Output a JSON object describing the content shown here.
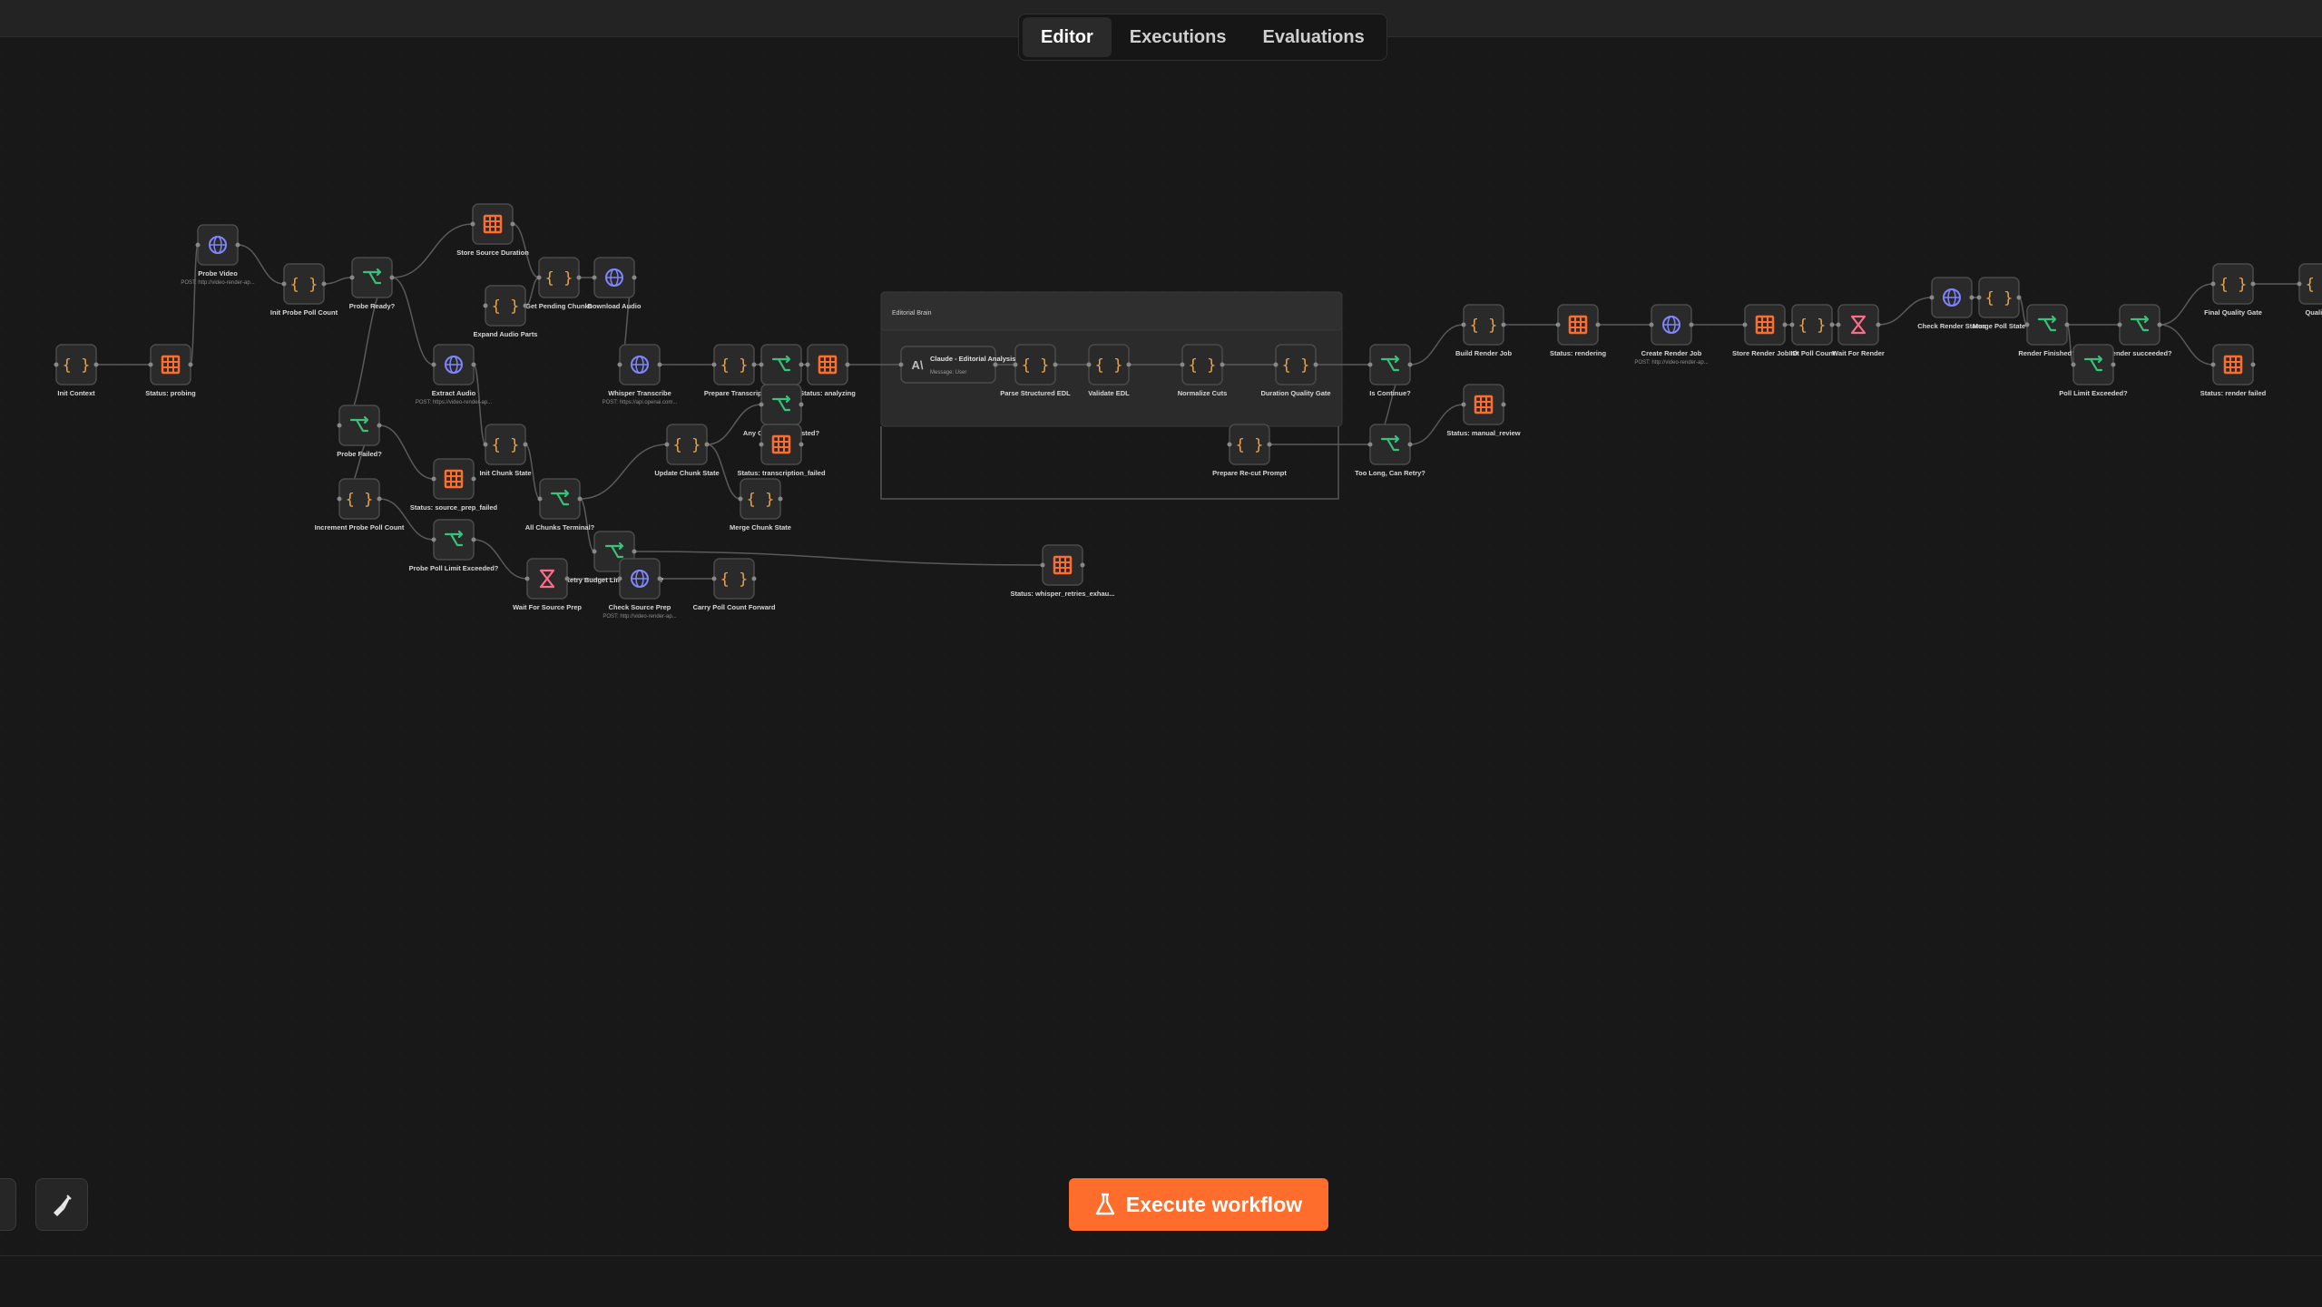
{
  "tabs": [
    {
      "label": "Editor",
      "active": true
    },
    {
      "label": "Executions",
      "active": false
    },
    {
      "label": "Evaluations",
      "active": false
    }
  ],
  "execute_button": {
    "label": "Execute workflow"
  },
  "group": {
    "title": "Editorial Brain"
  },
  "colors": {
    "code": "#e8a24a",
    "table": "#ff6d2d",
    "http": "#7f86ff",
    "if": "#39c37a",
    "wait": "#ff6b8a",
    "ai": "#bdbdbd"
  },
  "nodes": [
    {
      "id": "n0",
      "label": "Init Context",
      "type": "code"
    },
    {
      "id": "n1",
      "label": "Status: probing",
      "type": "table"
    },
    {
      "id": "n2",
      "label": "Probe Video",
      "sub": "POST: http://video-render-ap...",
      "type": "http"
    },
    {
      "id": "n3",
      "label": "Init Probe Poll Count",
      "type": "code"
    },
    {
      "id": "n4",
      "label": "Probe Ready?",
      "type": "if"
    },
    {
      "id": "n5",
      "label": "Store Source Duration",
      "type": "table"
    },
    {
      "id": "n6",
      "label": "Get Pending Chunks",
      "type": "code"
    },
    {
      "id": "n7",
      "label": "Download Audio",
      "type": "http"
    },
    {
      "id": "n8",
      "label": "Expand Audio Parts",
      "type": "code"
    },
    {
      "id": "n9",
      "label": "Extract Audio",
      "sub": "POST: https://video-render-ap...",
      "type": "http"
    },
    {
      "id": "n10",
      "label": "Whisper Transcribe",
      "sub": "POST: https://api.openai.com...",
      "type": "http"
    },
    {
      "id": "n11",
      "label": "Prepare Transcript",
      "type": "code"
    },
    {
      "id": "n12",
      "label": "",
      "type": "if"
    },
    {
      "id": "n13",
      "label": "Status: analyzing",
      "type": "table"
    },
    {
      "id": "n14",
      "label": "Probe Failed?",
      "type": "if"
    },
    {
      "id": "n15",
      "label": "Init Chunk State",
      "type": "code"
    },
    {
      "id": "n16",
      "label": "Update Chunk State",
      "type": "code"
    },
    {
      "id": "n17",
      "label": "Any Chunk Exhausted?",
      "type": "if"
    },
    {
      "id": "n18",
      "label": "Status: transcription_failed",
      "type": "table"
    },
    {
      "id": "n19",
      "label": "Status: source_prep_failed",
      "type": "table"
    },
    {
      "id": "n20",
      "label": "Increment Probe Poll Count",
      "type": "code"
    },
    {
      "id": "n21",
      "label": "All Chunks Terminal?",
      "type": "if"
    },
    {
      "id": "n22",
      "label": "Merge Chunk State",
      "type": "code"
    },
    {
      "id": "n23",
      "label": "Probe Poll Limit Exceeded?",
      "type": "if"
    },
    {
      "id": "n24",
      "label": "Retry Budget Limit Exceeded?",
      "type": "if"
    },
    {
      "id": "n25",
      "label": "Wait For Source Prep",
      "type": "wait"
    },
    {
      "id": "n26",
      "label": "Check Source Prep",
      "sub": "POST: http://video-render-ap...",
      "type": "http"
    },
    {
      "id": "n27",
      "label": "Carry Poll Count Forward",
      "type": "code"
    },
    {
      "id": "n28",
      "label": "Status: whisper_retries_exhau...",
      "type": "table"
    },
    {
      "id": "n29",
      "label": "Parse Structured EDL",
      "type": "code"
    },
    {
      "id": "n30",
      "label": "Validate EDL",
      "type": "code"
    },
    {
      "id": "n31",
      "label": "Normalize Cuts",
      "type": "code"
    },
    {
      "id": "n32",
      "label": "Duration Quality Gate",
      "type": "code"
    },
    {
      "id": "n33",
      "label": "Is Continue?",
      "type": "if"
    },
    {
      "id": "n34",
      "label": "Prepare Re-cut Prompt",
      "type": "code"
    },
    {
      "id": "n35",
      "label": "Too Long, Can Retry?",
      "type": "if"
    },
    {
      "id": "n36",
      "label": "Status: manual_review",
      "type": "table"
    },
    {
      "id": "n37",
      "label": "Build Render Job",
      "type": "code"
    },
    {
      "id": "n38",
      "label": "Status: rendering",
      "type": "table"
    },
    {
      "id": "n39",
      "label": "Create Render Job",
      "sub": "POST: http://video-render-ap...",
      "type": "http"
    },
    {
      "id": "n40",
      "label": "Store Render Job ID",
      "type": "table"
    },
    {
      "id": "n41",
      "label": "Init Poll Count",
      "type": "code"
    },
    {
      "id": "n42",
      "label": "Wait For Render",
      "type": "wait"
    },
    {
      "id": "n43",
      "label": "Check Render Status",
      "type": "http"
    },
    {
      "id": "n44",
      "label": "Merge Poll State",
      "type": "code"
    },
    {
      "id": "n45",
      "label": "Render Finished?",
      "type": "if"
    },
    {
      "id": "n46",
      "label": "Render succeeded?",
      "type": "if"
    },
    {
      "id": "n47",
      "label": "Poll Limit Exceeded?",
      "type": "if"
    },
    {
      "id": "n48",
      "label": "Final Quality Gate",
      "type": "code"
    },
    {
      "id": "n49",
      "label": "Quality...",
      "type": "code"
    },
    {
      "id": "n50",
      "label": "Status: render failed",
      "type": "table"
    },
    {
      "id": "n51",
      "label": "Claude - Editorial Analysis",
      "sub": "Message: User",
      "type": "ai"
    }
  ],
  "edges": [
    [
      "n0",
      "n1"
    ],
    [
      "n1",
      "n2"
    ],
    [
      "n2",
      "n3"
    ],
    [
      "n3",
      "n4"
    ],
    [
      "n4",
      "n5"
    ],
    [
      "n4",
      "n9"
    ],
    [
      "n5",
      "n6"
    ],
    [
      "n6",
      "n7"
    ],
    [
      "n8",
      "n6"
    ],
    [
      "n7",
      "n10"
    ],
    [
      "n9",
      "n15"
    ],
    [
      "n10",
      "n11"
    ],
    [
      "n11",
      "n12"
    ],
    [
      "n12",
      "n13"
    ],
    [
      "n13",
      "n51"
    ],
    [
      "n51",
      "n29"
    ],
    [
      "n29",
      "n30"
    ],
    [
      "n30",
      "n31"
    ],
    [
      "n31",
      "n32"
    ],
    [
      "n32",
      "n33"
    ],
    [
      "n33",
      "n37"
    ],
    [
      "n33",
      "n35"
    ],
    [
      "n35",
      "n34"
    ],
    [
      "n35",
      "n36"
    ],
    [
      "n37",
      "n38"
    ],
    [
      "n38",
      "n39"
    ],
    [
      "n39",
      "n40"
    ],
    [
      "n40",
      "n41"
    ],
    [
      "n41",
      "n42"
    ],
    [
      "n42",
      "n43"
    ],
    [
      "n43",
      "n44"
    ],
    [
      "n44",
      "n45"
    ],
    [
      "n45",
      "n46"
    ],
    [
      "n45",
      "n47"
    ],
    [
      "n46",
      "n48"
    ],
    [
      "n46",
      "n50"
    ],
    [
      "n48",
      "n49"
    ],
    [
      "n14",
      "n19"
    ],
    [
      "n14",
      "n20"
    ],
    [
      "n20",
      "n23"
    ],
    [
      "n23",
      "n25"
    ],
    [
      "n25",
      "n26"
    ],
    [
      "n26",
      "n27"
    ],
    [
      "n15",
      "n21"
    ],
    [
      "n21",
      "n16"
    ],
    [
      "n21",
      "n24"
    ],
    [
      "n24",
      "n28"
    ],
    [
      "n16",
      "n17"
    ],
    [
      "n17",
      "n18"
    ],
    [
      "n16",
      "n22"
    ],
    [
      "n4",
      "n14"
    ]
  ]
}
